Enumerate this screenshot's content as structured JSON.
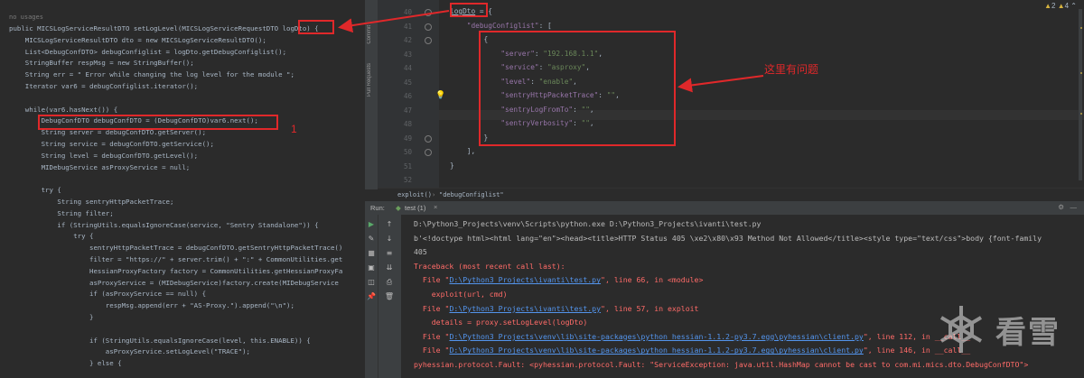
{
  "left_code": {
    "usages": "no usages",
    "lines": [
      "public MICSLogServiceResultDTO setLogLevel(MICSLogServiceRequestDTO logDto) {",
      "    MICSLogServiceResultDTO dto = new MICSLogServiceResultDTO();",
      "    List<DebugConfDTO> debugConfiglist = logDto.getDebugConfiglist();",
      "    StringBuffer respMsg = new StringBuffer();",
      "    String err = \" Error while changing the log level for the module \";",
      "    Iterator var6 = debugConfiglist.iterator();",
      "",
      "    while(var6.hasNext()) {",
      "        DebugConfDTO debugConfDTO = (DebugConfDTO)var6.next();",
      "        String server = debugConfDTO.getServer();",
      "        String service = debugConfDTO.getService();",
      "        String level = debugConfDTO.getLevel();",
      "        MIDebugService asProxyService = null;",
      "",
      "        try {",
      "            String sentryHttpPacketTrace;",
      "            String filter;",
      "            if (StringUtils.equalsIgnoreCase(service, \"Sentry Standalone\")) {",
      "                try {",
      "                    sentryHttpPacketTrace = debugConfDTO.getSentryHttpPacketTrace()",
      "                    filter = \"https://\" + server.trim() + \":\" + CommonUtilities.get",
      "                    HessianProxyFactory factory = CommonUtilities.getHessianProxyFa",
      "                    asProxyService = (MIDebugService)factory.create(MIDebugService",
      "                    if (asProxyService == null) {",
      "                        respMsg.append(err + \"AS-Proxy.\").append(\"\\n\");",
      "                    }",
      "",
      "                    if (StringUtils.equalsIgnoreCase(level, this.ENABLE)) {",
      "                        asProxyService.setLogLevel(\"TRACE\");",
      "                    } else {"
    ],
    "annotation_number": "1"
  },
  "sidebar_tabs": [
    "Commit",
    "Pull Requests"
  ],
  "right_code": {
    "gutter_numbers": [
      "40",
      "41",
      "42",
      "43",
      "44",
      "45",
      "46",
      "47",
      "48",
      "49",
      "50",
      "51",
      "52"
    ],
    "warnings": {
      "warn_count": "2",
      "weak_count": "4"
    },
    "lines": [
      {
        "segments": [
          {
            "t": "logDto",
            "c": "pun"
          },
          {
            "t": " = {",
            "c": "pun"
          }
        ]
      },
      {
        "segments": [
          {
            "t": "    \"debugConfiglist\"",
            "c": "key"
          },
          {
            "t": ": [",
            "c": "pun"
          }
        ]
      },
      {
        "segments": [
          {
            "t": "        {",
            "c": "pun"
          }
        ]
      },
      {
        "segments": [
          {
            "t": "            \"server\"",
            "c": "key"
          },
          {
            "t": ": ",
            "c": "pun"
          },
          {
            "t": "\"192.168.1.1\"",
            "c": "str"
          },
          {
            "t": ",",
            "c": "pun"
          }
        ]
      },
      {
        "segments": [
          {
            "t": "            \"service\"",
            "c": "key"
          },
          {
            "t": ": ",
            "c": "pun"
          },
          {
            "t": "\"asproxy\"",
            "c": "str"
          },
          {
            "t": ",",
            "c": "pun"
          }
        ]
      },
      {
        "segments": [
          {
            "t": "            \"level\"",
            "c": "key"
          },
          {
            "t": ": ",
            "c": "pun"
          },
          {
            "t": "\"enable\"",
            "c": "str"
          },
          {
            "t": ",",
            "c": "pun"
          }
        ]
      },
      {
        "segments": [
          {
            "t": "            \"sentryHttpPacketTrace\"",
            "c": "key"
          },
          {
            "t": ": ",
            "c": "pun"
          },
          {
            "t": "\"\"",
            "c": "str"
          },
          {
            "t": ",",
            "c": "pun"
          }
        ]
      },
      {
        "segments": [
          {
            "t": "            \"sentryLogFromTo\"",
            "c": "key"
          },
          {
            "t": ": ",
            "c": "pun"
          },
          {
            "t": "\"\"",
            "c": "str"
          },
          {
            "t": ",",
            "c": "pun"
          }
        ]
      },
      {
        "segments": [
          {
            "t": "            \"sentryVerbosity\"",
            "c": "key"
          },
          {
            "t": ": ",
            "c": "pun"
          },
          {
            "t": "\"\"",
            "c": "str"
          },
          {
            "t": ",",
            "c": "pun"
          }
        ]
      },
      {
        "segments": [
          {
            "t": "        }",
            "c": "pun"
          }
        ]
      },
      {
        "segments": [
          {
            "t": "    ],",
            "c": "pun"
          }
        ]
      },
      {
        "segments": [
          {
            "t": "}",
            "c": "pun"
          }
        ]
      },
      {
        "segments": [
          {
            "t": "",
            "c": "pun"
          }
        ]
      }
    ],
    "annotation_text": "这里有问题"
  },
  "breadcrumb": {
    "items": [
      "exploit()",
      "\"debugConfiglist\""
    ]
  },
  "run_panel": {
    "label": "Run:",
    "tab": "test (1)",
    "lines": [
      {
        "text": "D:\\Python3_Projects\\venv\\Scripts\\python.exe D:\\Python3_Projects\\ivanti\\test.py",
        "kind": "normal"
      },
      {
        "text": "b'<!doctype html><html lang=\"en\"><head><title>HTTP Status 405 \\xe2\\x80\\x93 Method Not Allowed</title><style type=\"text/css\">body {font-family",
        "kind": "normal"
      },
      {
        "text": "405",
        "kind": "normal"
      },
      {
        "text": "Traceback (most recent call last):",
        "kind": "err"
      },
      {
        "pre": "  File \"",
        "link": "D:\\Python3_Projects\\ivanti\\test.py",
        "post": "\", line 66, in <module>",
        "kind": "err"
      },
      {
        "text": "    exploit(url, cmd)",
        "kind": "err"
      },
      {
        "pre": "  File \"",
        "link": "D:\\Python3_Projects\\ivanti\\test.py",
        "post": "\", line 57, in exploit",
        "kind": "err"
      },
      {
        "text": "    details = proxy.setLogLevel(logDto)",
        "kind": "err"
      },
      {
        "pre": "  File \"",
        "link": "D:\\Python3_Projects\\venv\\lib\\site-packages\\python_hessian-1.1.2-py3.7.egg\\pyhessian\\client.py",
        "post": "\", line 112, in __call__",
        "kind": "err"
      },
      {
        "pre": "  File \"",
        "link": "D:\\Python3_Projects\\venv\\lib\\site-packages\\python_hessian-1.1.2-py3.7.egg\\pyhessian\\client.py",
        "post": "\", line 146, in __call__",
        "kind": "err"
      },
      {
        "text": "pyhessian.protocol.Fault: <pyhessian.protocol.Fault: \"ServiceException: java.util.HashMap cannot be cast to com.mi.mics.dto.DebugConfDTO\">",
        "kind": "err"
      }
    ]
  },
  "watermark_text": "看雪",
  "colors": {
    "annotation_red": "#e0282a",
    "error_red": "#ff6b68",
    "link_blue": "#5394ec",
    "string_green": "#6a8759",
    "key_purple": "#9876aa"
  }
}
